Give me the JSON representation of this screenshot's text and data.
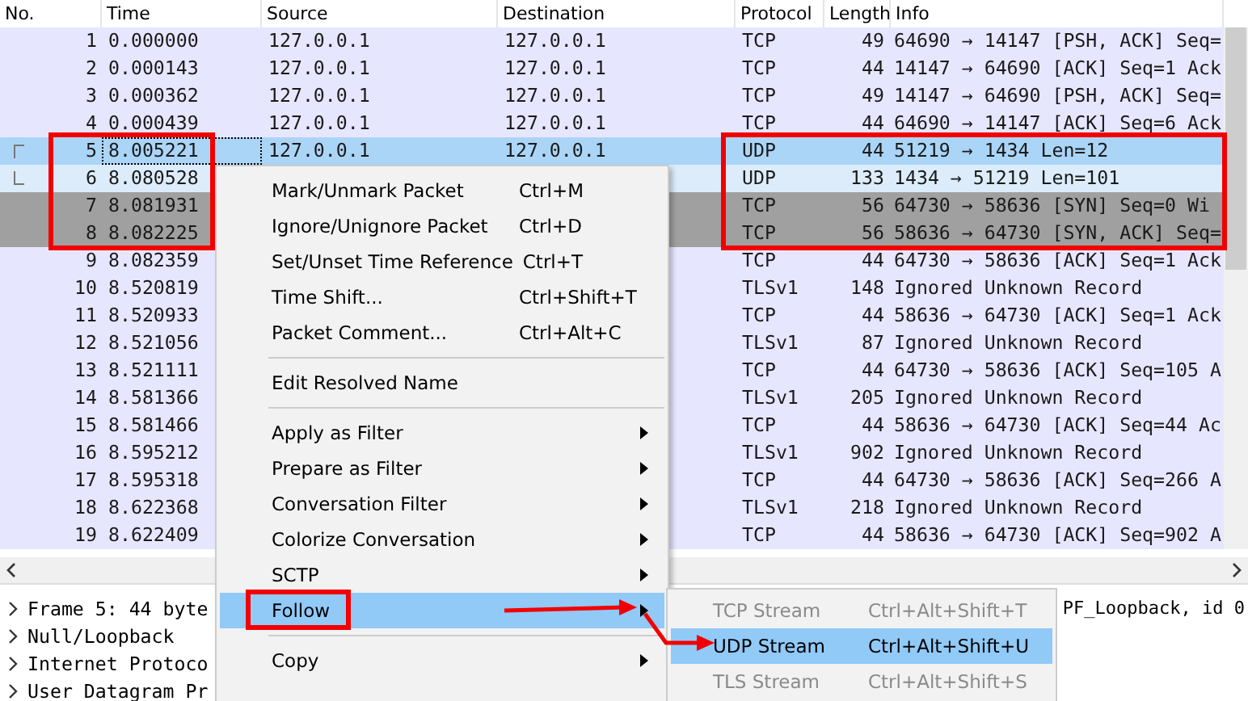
{
  "packet_list": {
    "columns": [
      "No.",
      "Time",
      "Source",
      "Destination",
      "Protocol",
      "Length",
      "Info"
    ],
    "rows": [
      {
        "no": "1",
        "time": "0.000000",
        "source": "127.0.0.1",
        "destination": "127.0.0.1",
        "protocol": "TCP",
        "length": "49",
        "info": "64690 → 14147 [PSH, ACK] Seq=",
        "kind": "plain",
        "selected": false
      },
      {
        "no": "2",
        "time": "0.000143",
        "source": "127.0.0.1",
        "destination": "127.0.0.1",
        "protocol": "TCP",
        "length": "44",
        "info": "14147 → 64690 [ACK] Seq=1 Ack",
        "kind": "plain",
        "selected": false
      },
      {
        "no": "3",
        "time": "0.000362",
        "source": "127.0.0.1",
        "destination": "127.0.0.1",
        "protocol": "TCP",
        "length": "49",
        "info": "14147 → 64690 [PSH, ACK] Seq=",
        "kind": "plain",
        "selected": false
      },
      {
        "no": "4",
        "time": "0.000439",
        "source": "127.0.0.1",
        "destination": "127.0.0.1",
        "protocol": "TCP",
        "length": "44",
        "info": "64690 → 14147 [ACK] Seq=6 Ack",
        "kind": "plain",
        "selected": false
      },
      {
        "no": "5",
        "time": "8.005221",
        "source": "127.0.0.1",
        "destination": "127.0.0.1",
        "protocol": "UDP",
        "length": "44",
        "info": "51219 → 1434 Len=12",
        "selected": true
      },
      {
        "no": "6",
        "time": "8.080528",
        "protocol": "UDP",
        "length": "133",
        "info": "1434 → 51219 Len=101",
        "kind": "related",
        "selected": false
      },
      {
        "no": "7",
        "time": "8.081931",
        "protocol": "TCP",
        "length": "56",
        "info": "64730 → 58636 [SYN] Seq=0 Wi",
        "kind": "grey",
        "selected": false
      },
      {
        "no": "8",
        "time": "8.082225",
        "protocol": "TCP",
        "length": "56",
        "info": "58636 → 64730 [SYN, ACK] Seq=",
        "kind": "grey",
        "selected": false
      },
      {
        "no": "9",
        "time": "8.082359",
        "protocol": "TCP",
        "length": "44",
        "info": "64730 → 58636 [ACK] Seq=1 Ack",
        "kind": "plain",
        "selected": false
      },
      {
        "no": "10",
        "time": "8.520819",
        "protocol": "TLSv1",
        "length": "148",
        "info": "Ignored Unknown Record",
        "kind": "plain",
        "selected": false
      },
      {
        "no": "11",
        "time": "8.520933",
        "protocol": "TCP",
        "length": "44",
        "info": "58636 → 64730 [ACK] Seq=1 Ack",
        "kind": "plain",
        "selected": false
      },
      {
        "no": "12",
        "time": "8.521056",
        "protocol": "TLSv1",
        "length": "87",
        "info": "Ignored Unknown Record",
        "kind": "plain",
        "selected": false
      },
      {
        "no": "13",
        "time": "8.521111",
        "protocol": "TCP",
        "length": "44",
        "info": "64730 → 58636 [ACK] Seq=105 A",
        "kind": "plain",
        "selected": false
      },
      {
        "no": "14",
        "time": "8.581366",
        "protocol": "TLSv1",
        "length": "205",
        "info": "Ignored Unknown Record",
        "kind": "plain",
        "selected": false
      },
      {
        "no": "15",
        "time": "8.581466",
        "protocol": "TCP",
        "length": "44",
        "info": "58636 → 64730 [ACK] Seq=44 Ac",
        "kind": "plain",
        "selected": false
      },
      {
        "no": "16",
        "time": "8.595212",
        "protocol": "TLSv1",
        "length": "902",
        "info": "Ignored Unknown Record",
        "kind": "plain",
        "selected": false
      },
      {
        "no": "17",
        "time": "8.595318",
        "protocol": "TCP",
        "length": "44",
        "info": "64730 → 58636 [ACK] Seq=266 A",
        "kind": "plain",
        "selected": false
      },
      {
        "no": "18",
        "time": "8.622368",
        "protocol": "TLSv1",
        "length": "218",
        "info": "Ignored Unknown Record",
        "kind": "plain",
        "selected": false
      },
      {
        "no": "19",
        "time": "8.622409",
        "protocol": "TCP",
        "length": "44",
        "info": "58636 → 64730 [ACK] Seq=902 A",
        "kind": "plain",
        "selected": false
      }
    ]
  },
  "packet_details": [
    {
      "text": "Frame 5: 44 byte",
      "tail": "PF_Loopback, id 0",
      "expanded": false
    },
    {
      "text": "Null/Loopback",
      "expanded": false
    },
    {
      "text": "Internet Protoco",
      "expanded": false
    },
    {
      "text": "User Datagram Pr",
      "expanded": false
    }
  ],
  "context_menu": {
    "items": [
      {
        "kind": "command",
        "label": "Mark/Unmark Packet",
        "shortcut": "Ctrl+M",
        "selected": false
      },
      {
        "kind": "command",
        "label": "Ignore/Unignore Packet",
        "shortcut": "Ctrl+D",
        "selected": false
      },
      {
        "kind": "command",
        "label": "Set/Unset Time Reference",
        "shortcut": "Ctrl+T",
        "selected": false
      },
      {
        "kind": "command",
        "label": "Time Shift...",
        "shortcut": "Ctrl+Shift+T",
        "selected": false
      },
      {
        "kind": "command",
        "label": "Packet Comment...",
        "shortcut": "Ctrl+Alt+C",
        "selected": false
      },
      {
        "kind": "separator"
      },
      {
        "kind": "command",
        "label": "Edit Resolved Name",
        "selected": false
      },
      {
        "kind": "separator"
      },
      {
        "kind": "submenu",
        "label": "Apply as Filter",
        "selected": false
      },
      {
        "kind": "submenu",
        "label": "Prepare as Filter",
        "selected": false
      },
      {
        "kind": "submenu",
        "label": "Conversation Filter",
        "selected": false
      },
      {
        "kind": "submenu",
        "label": "Colorize Conversation",
        "selected": false
      },
      {
        "kind": "submenu",
        "label": "SCTP",
        "selected": false
      },
      {
        "kind": "submenu",
        "label": "Follow",
        "selected": true
      },
      {
        "kind": "separator"
      },
      {
        "kind": "submenu",
        "label": "Copy",
        "selected": false
      }
    ]
  },
  "follow_submenu": {
    "items": [
      {
        "label": "TCP Stream",
        "shortcut": "Ctrl+Alt+Shift+T",
        "disabled": true,
        "selected": false
      },
      {
        "label": "UDP Stream",
        "shortcut": "Ctrl+Alt+Shift+U",
        "disabled": false,
        "selected": true
      },
      {
        "label": "TLS Stream",
        "shortcut": "Ctrl+Alt+Shift+S",
        "disabled": true,
        "selected": false
      }
    ]
  }
}
